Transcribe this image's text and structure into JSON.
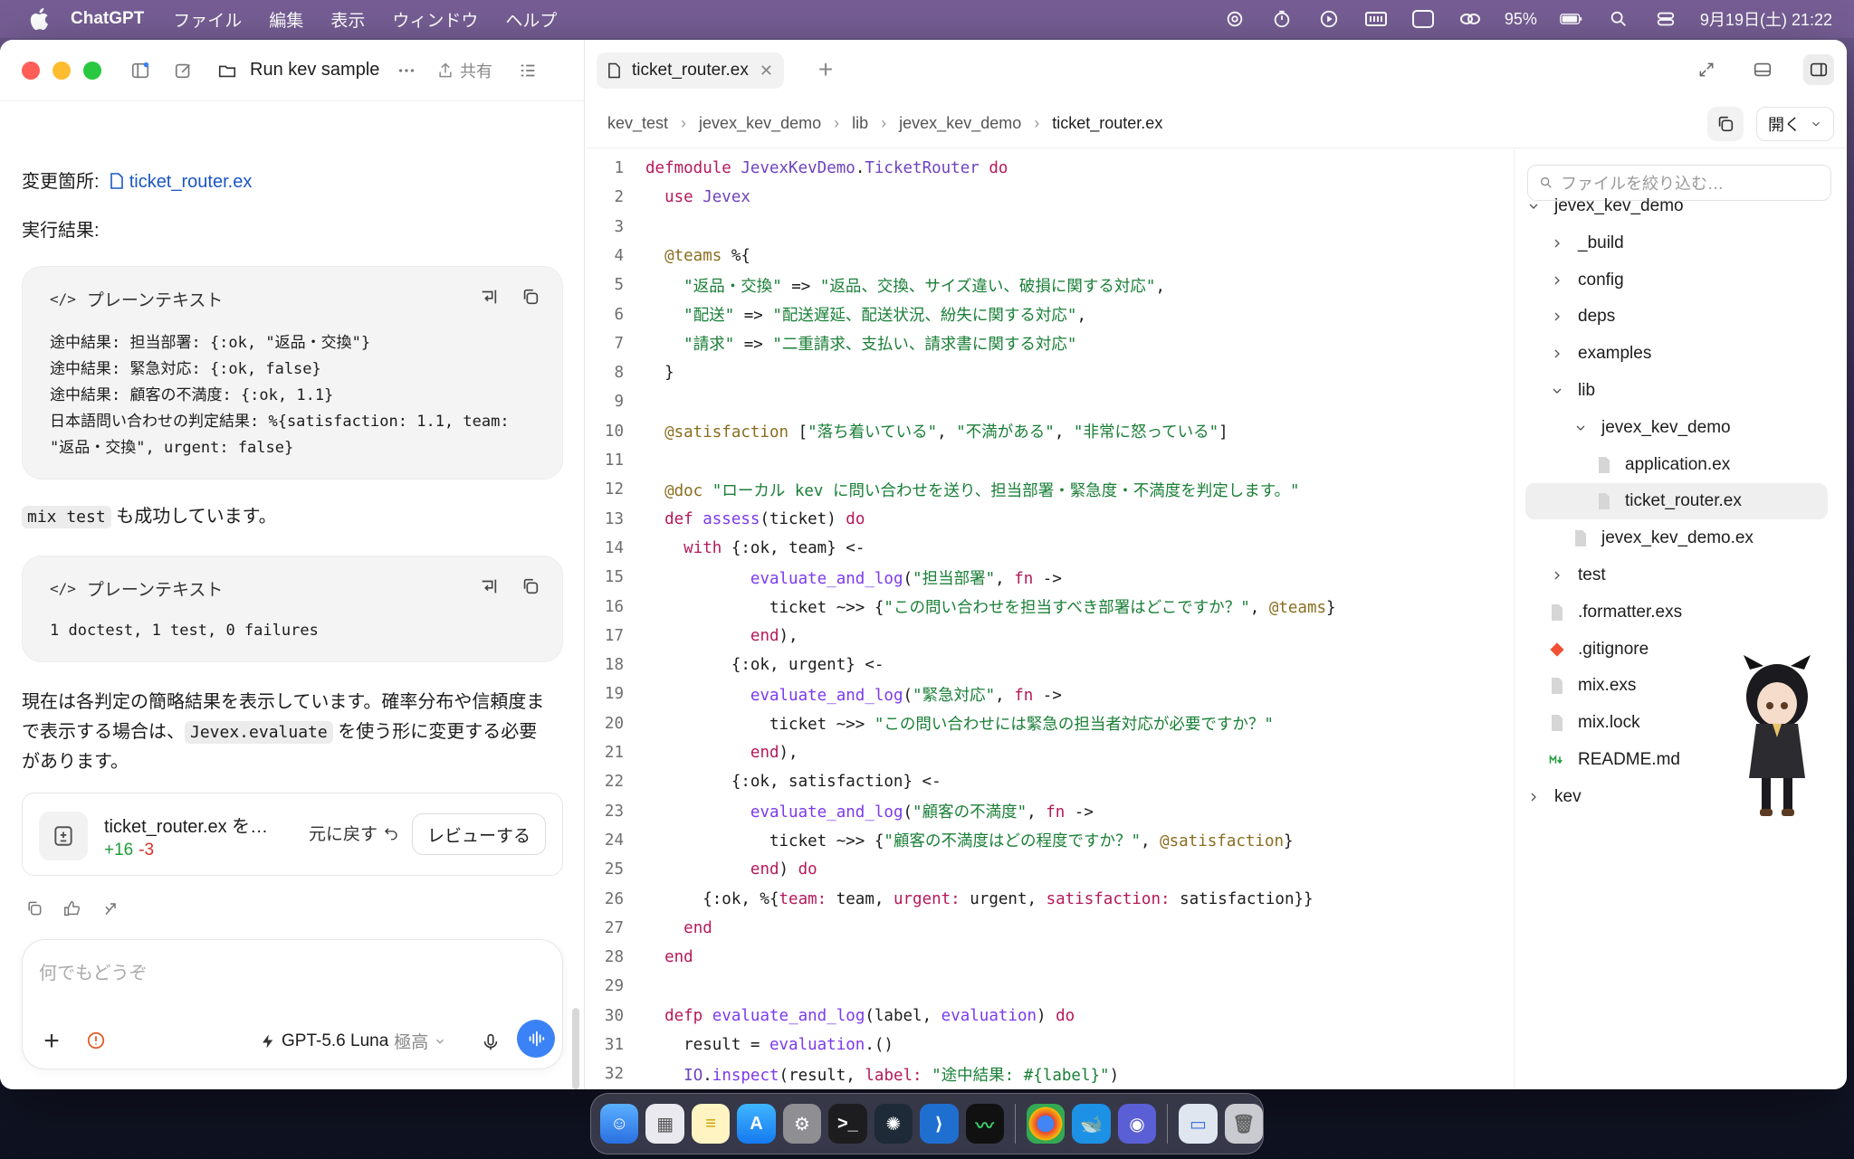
{
  "menubar": {
    "app_name": "ChatGPT",
    "menus": [
      "ファイル",
      "編集",
      "表示",
      "ウィンドウ",
      "ヘルプ"
    ],
    "battery": "95%",
    "datetime": "9月19日(土) 21:22",
    "input_indicator": "A"
  },
  "chat": {
    "title": "Run kev sample",
    "share_label": "共有",
    "changed_label": "変更箇所:",
    "changed_file": "ticket_router.ex",
    "result_label": "実行結果:",
    "code_blocks": [
      {
        "lang": "プレーンテキスト",
        "lines": [
          "途中結果: 担当部署: {:ok, \"返品・交換\"}",
          "途中結果: 緊急対応: {:ok, false}",
          "途中結果: 顧客の不満度: {:ok, 1.1}",
          "日本語問い合わせの判定結果: %{satisfaction: 1.1, team:",
          "\"返品・交換\", urgent: false}"
        ]
      },
      {
        "lang": "プレーンテキスト",
        "lines": [
          "1 doctest, 1 test, 0 failures"
        ]
      }
    ],
    "mix_test_code": "mix test",
    "mix_test_text": "も成功しています。",
    "summary_line1": "現在は各判定の簡略結果を表示しています。確率分布や信頼度ま",
    "summary_line2_pre": "で表示する場合は、",
    "summary_code": "Jevex.evaluate",
    "summary_line2_post": "を使う形に変更する必要",
    "summary_line3": "があります。",
    "change_card": {
      "file": "ticket_router.ex を…",
      "additions": "+16",
      "deletions": "-3",
      "revert_label": "元に戻す",
      "review_label": "レビューする"
    },
    "composer": {
      "placeholder": "何でもどうぞ",
      "model": "GPT-5.6 Luna",
      "level": "極高"
    }
  },
  "editor": {
    "tab": "ticket_router.ex",
    "breadcrumb": [
      "kev_test",
      "jevex_kev_demo",
      "lib",
      "jevex_kev_demo",
      "ticket_router.ex"
    ],
    "open_label": "開く",
    "lines": [
      "defmodule JevexKevDemo.TicketRouter do",
      "  use Jevex",
      "",
      "  @teams %{",
      "    \"返品・交換\" => \"返品、交換、サイズ違い、破損に関する対応\",",
      "    \"配送\" => \"配送遅延、配送状況、紛失に関する対応\",",
      "    \"請求\" => \"二重請求、支払い、請求書に関する対応\"",
      "  }",
      "",
      "  @satisfaction [\"落ち着いている\", \"不満がある\", \"非常に怒っている\"]",
      "",
      "  @doc \"ローカル kev に問い合わせを送り、担当部署・緊急度・不満度を判定します。\"",
      "  def assess(ticket) do",
      "    with {:ok, team} <-",
      "           evaluate_and_log(\"担当部署\", fn ->",
      "             ticket ~>> {\"この問い合わせを担当すべき部署はどこですか？\", @teams}",
      "           end),",
      "         {:ok, urgent} <-",
      "           evaluate_and_log(\"緊急対応\", fn ->",
      "             ticket ~>> \"この問い合わせには緊急の担当者対応が必要ですか？\"",
      "           end),",
      "         {:ok, satisfaction} <-",
      "           evaluate_and_log(\"顧客の不満度\", fn ->",
      "             ticket ~>> {\"顧客の不満度はどの程度ですか？\", @satisfaction}",
      "           end) do",
      "      {:ok, %{team: team, urgent: urgent, satisfaction: satisfaction}}",
      "    end",
      "  end",
      "",
      "  defp evaluate_and_log(label, evaluation) do",
      "    result = evaluation.()",
      "    IO.inspect(result, label: \"途中結果: #{label}\")"
    ]
  },
  "file_tree": {
    "filter_placeholder": "ファイルを絞り込む…",
    "items": [
      {
        "label": "jevex_kev_demo",
        "type": "folder-open"
      },
      {
        "label": "_build",
        "type": "folder"
      },
      {
        "label": "config",
        "type": "folder"
      },
      {
        "label": "deps",
        "type": "folder"
      },
      {
        "label": "examples",
        "type": "folder"
      },
      {
        "label": "lib",
        "type": "folder-open"
      },
      {
        "label": "jevex_kev_demo",
        "type": "folder-open"
      },
      {
        "label": "application.ex",
        "type": "file"
      },
      {
        "label": "ticket_router.ex",
        "type": "file"
      },
      {
        "label": "jevex_kev_demo.ex",
        "type": "file"
      },
      {
        "label": "test",
        "type": "folder"
      },
      {
        "label": ".formatter.exs",
        "type": "file"
      },
      {
        "label": ".gitignore",
        "type": "git"
      },
      {
        "label": "mix.exs",
        "type": "file"
      },
      {
        "label": "mix.lock",
        "type": "file"
      },
      {
        "label": "README.md",
        "type": "markdown"
      },
      {
        "label": "kev",
        "type": "folder"
      }
    ]
  },
  "colors": {
    "accent": "#3b82f6",
    "link": "#1a56c4",
    "additions": "#1f9d3a",
    "deletions": "#d93025"
  }
}
